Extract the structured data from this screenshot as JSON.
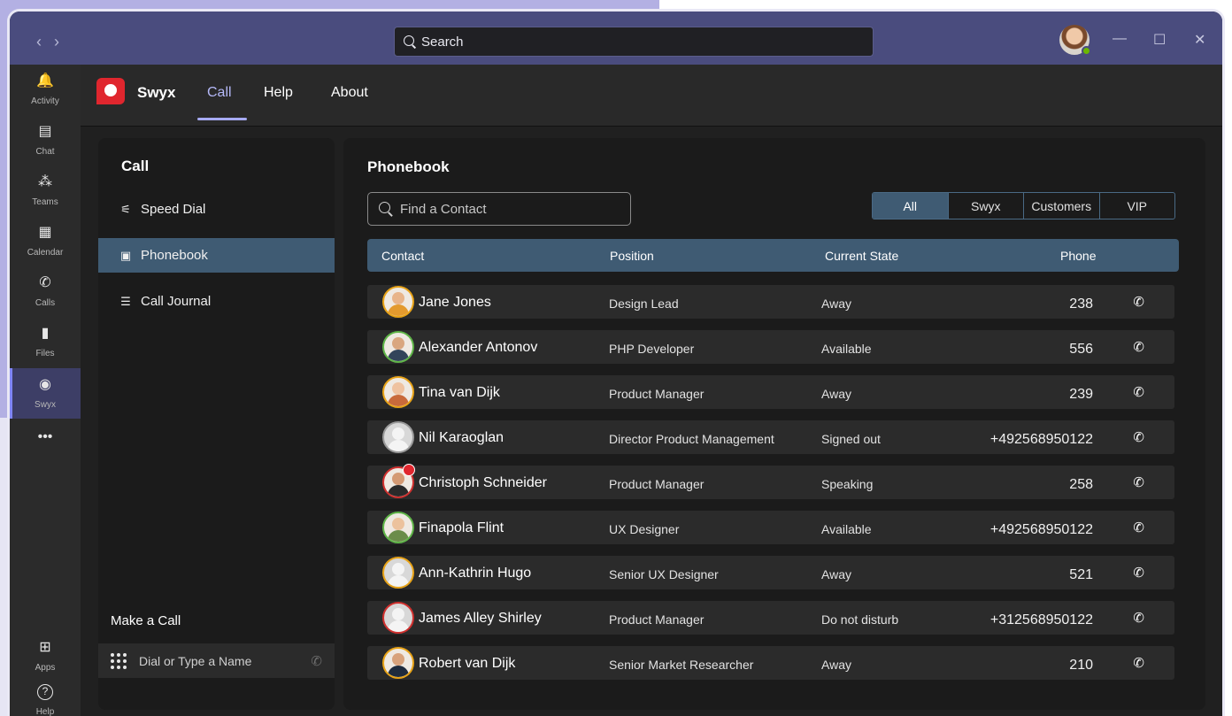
{
  "titlebar": {
    "search_label": "Search",
    "nav_back": "‹",
    "nav_forward": "›",
    "minimize": "—",
    "maximize": "☐",
    "close": "✕"
  },
  "rail": [
    {
      "label": "Activity",
      "icon": "bell-icon",
      "glyph": "🔔"
    },
    {
      "label": "Chat",
      "icon": "chat-icon",
      "glyph": "▤"
    },
    {
      "label": "Teams",
      "icon": "teams-icon",
      "glyph": "⁂"
    },
    {
      "label": "Calendar",
      "icon": "calendar-icon",
      "glyph": "▦"
    },
    {
      "label": "Calls",
      "icon": "phone-icon",
      "glyph": "✆"
    },
    {
      "label": "Files",
      "icon": "file-icon",
      "glyph": "▮"
    },
    {
      "label": "Swyx",
      "icon": "swyx-icon",
      "glyph": "◉"
    },
    {
      "label": "",
      "icon": "more-icon",
      "glyph": "•••"
    },
    {
      "label": "Apps",
      "icon": "apps-icon",
      "glyph": "⊞"
    },
    {
      "label": "Help",
      "icon": "help-icon",
      "glyph": "?"
    }
  ],
  "app_header": {
    "brand": "Swyx",
    "tabs": [
      "Call",
      "Help",
      "About"
    ],
    "active_tab": "Call"
  },
  "left_panel": {
    "title": "Call",
    "items": [
      {
        "label": "Speed Dial",
        "icon": "speed-dial-icon",
        "glyph": "⚟"
      },
      {
        "label": "Phonebook",
        "icon": "phonebook-icon",
        "glyph": "▣"
      },
      {
        "label": "Call Journal",
        "icon": "call-journal-icon",
        "glyph": "☰"
      }
    ],
    "make_call_label": "Make a Call",
    "dial_placeholder": "Dial or Type a Name"
  },
  "phonebook": {
    "title": "Phonebook",
    "find_placeholder": "Find a Contact",
    "filters": [
      "All",
      "Swyx",
      "Customers",
      "VIP"
    ],
    "active_filter": "All",
    "columns": [
      "Contact",
      "Position",
      "Current State",
      "Phone"
    ],
    "contacts": [
      {
        "name": "Jane Jones",
        "position": "Design Lead",
        "state": "Away",
        "phone": "238"
      },
      {
        "name": "Alexander Antonov",
        "position": "PHP Developer",
        "state": "Available",
        "phone": "556"
      },
      {
        "name": "Tina van Dijk",
        "position": "Product Manager",
        "state": "Away",
        "phone": "239"
      },
      {
        "name": "Nil Karaoglan",
        "position": "Director Product Management",
        "state": "Signed out",
        "phone": "+492568950122"
      },
      {
        "name": "Christoph Schneider",
        "position": "Product Manager",
        "state": "Speaking",
        "phone": "258"
      },
      {
        "name": "Finapola Flint",
        "position": "UX Designer",
        "state": "Available",
        "phone": "+492568950122"
      },
      {
        "name": "Ann-Kathrin Hugo",
        "position": "Senior UX Designer",
        "state": "Away",
        "phone": "521"
      },
      {
        "name": "James Alley Shirley",
        "position": "Product Manager",
        "state": "Do not disturb",
        "phone": "+312568950122"
      },
      {
        "name": "Robert van Dijk",
        "position": "Senior Market Researcher",
        "state": "Away",
        "phone": "210"
      }
    ]
  },
  "colors": {
    "titlebar": "#4a4c7e",
    "accent": "#3f5b73",
    "brand_red": "#e0262e",
    "away": "#e8a317",
    "available": "#5fb548",
    "busy": "#d0302e",
    "offline": "#9a9a9a"
  }
}
